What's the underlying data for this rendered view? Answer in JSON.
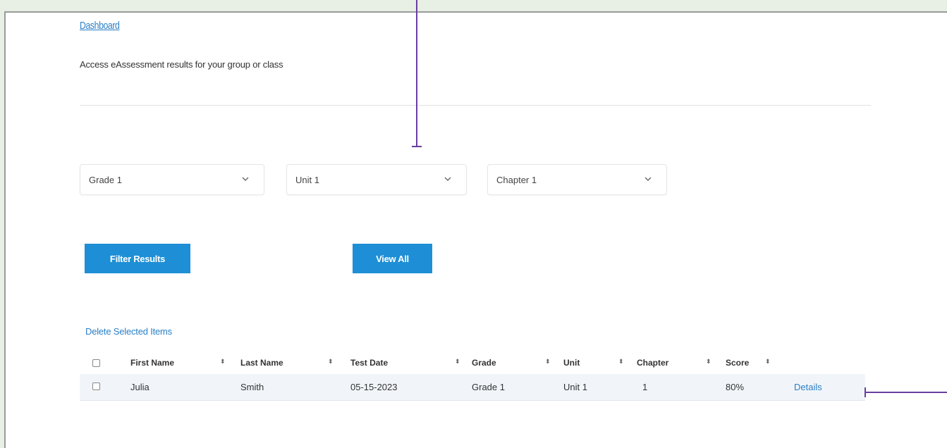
{
  "breadcrumb": {
    "label": "Dashboard"
  },
  "subtitle": "Access eAssessment results for your group or class",
  "filters": {
    "grade": {
      "value": "Grade 1"
    },
    "unit": {
      "value": "Unit 1"
    },
    "chapter": {
      "value": "Chapter 1"
    }
  },
  "buttons": {
    "filter_results": "Filter Results",
    "view_all": "View All"
  },
  "delete_link": "Delete Selected Items",
  "table": {
    "columns": [
      "First Name",
      "Last Name",
      "Test Date",
      "Grade",
      "Unit",
      "Chapter",
      "Score"
    ],
    "sort_glyph": "⬍",
    "rows": [
      {
        "first_name": "Julia",
        "last_name": "Smith",
        "test_date": "05-15-2023",
        "grade": "Grade 1",
        "unit": "Unit 1",
        "chapter": "1",
        "score": "80%",
        "action": "Details"
      }
    ]
  },
  "icons": {
    "dropdown": "chevron-down-icon",
    "checkbox": "checkbox-icon"
  },
  "colors": {
    "accent": "#1e8fd6",
    "link": "#2a7fc6",
    "callout": "#6a3ea1",
    "page_bg": "#e8efe4"
  }
}
